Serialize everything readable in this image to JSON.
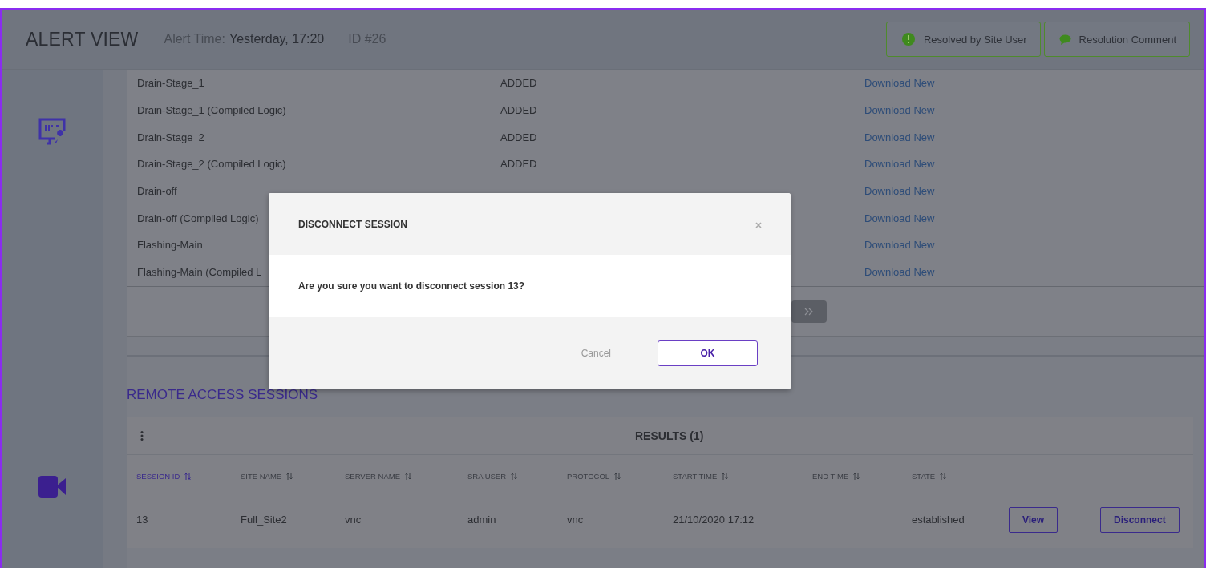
{
  "header": {
    "title": "ALERT VIEW",
    "alert_time_label": "Alert Time:",
    "alert_time": "Yesterday, 17:20",
    "alert_id": "ID #26",
    "actions": [
      {
        "kind": "resolved",
        "label": "Resolved by Site User"
      },
      {
        "kind": "comment",
        "label": "Resolution Comment"
      }
    ]
  },
  "changes_table": {
    "rows": [
      {
        "name": "Drain-Stage_1",
        "status": "ADDED",
        "action": "Download New"
      },
      {
        "name": "Drain-Stage_1 (Compiled Logic)",
        "status": "ADDED",
        "action": "Download New"
      },
      {
        "name": "Drain-Stage_2",
        "status": "ADDED",
        "action": "Download New"
      },
      {
        "name": "Drain-Stage_2 (Compiled Logic)",
        "status": "ADDED",
        "action": "Download New"
      },
      {
        "name": "Drain-off",
        "action": "Download New"
      },
      {
        "name": "Drain-off (Compiled Logic)",
        "action": "Download New"
      },
      {
        "name": "Flashing-Main",
        "action": "Download New"
      },
      {
        "name": "Flashing-Main (Compiled L",
        "action": "Download New"
      }
    ]
  },
  "sessions": {
    "title": "REMOTE ACCESS SESSIONS",
    "results": "RESULTS (1)",
    "columns": [
      {
        "label": "SESSION ID",
        "sorted": true
      },
      {
        "label": "SITE NAME",
        "sorted": false
      },
      {
        "label": "SERVER NAME",
        "sorted": false
      },
      {
        "label": "SRA USER",
        "sorted": false
      },
      {
        "label": "PROTOCOL",
        "sorted": false
      },
      {
        "label": "START TIME",
        "sorted": false
      },
      {
        "label": "END TIME",
        "sorted": false
      },
      {
        "label": "STATE",
        "sorted": false
      }
    ],
    "rows": [
      {
        "cells": [
          "13",
          "Full_Site2",
          "vnc",
          "admin",
          "vnc",
          "21/10/2020 17:12",
          "",
          "established"
        ],
        "actions": [
          "View",
          "Disconnect"
        ]
      }
    ]
  },
  "modal": {
    "title": "DISCONNECT SESSION",
    "message": "Are you sure you want to disconnect session 13?",
    "cancel": "Cancel",
    "ok": "OK"
  }
}
